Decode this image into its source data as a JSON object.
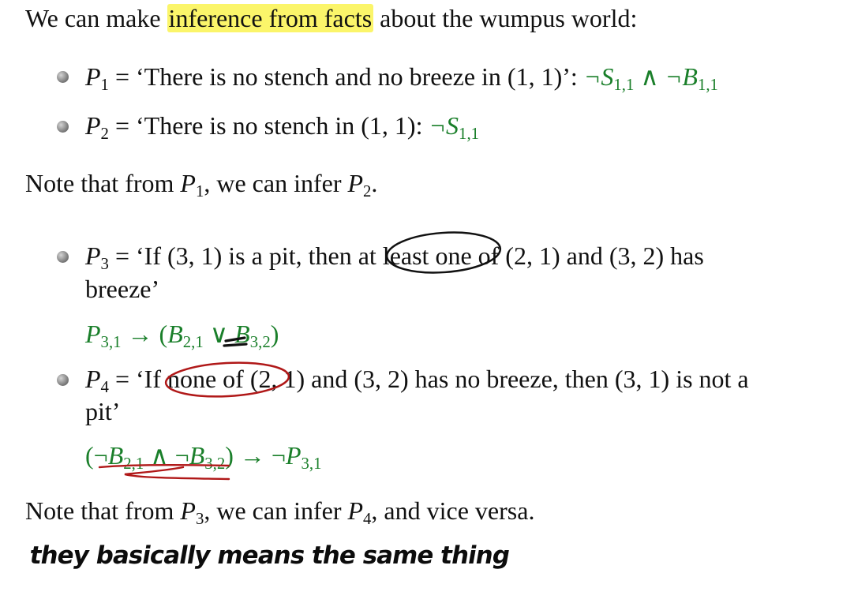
{
  "intro": {
    "before": "We can make ",
    "highlight": "inference from facts",
    "after": " about the wumpus world:"
  },
  "p1": {
    "var": "P",
    "sub": "1",
    "text": " = ‘There is no stench and no breeze in (1, 1)’: ",
    "formula": {
      "neg1": "¬S",
      "sub1": "1,1",
      "and": " ∧ ",
      "neg2": "¬B",
      "sub2": "1,1"
    }
  },
  "p2": {
    "var": "P",
    "sub": "2",
    "text": " = ‘There is no stench in (1, 1): ",
    "formula": {
      "neg": "¬S",
      "sub": "1,1"
    }
  },
  "note1": {
    "before": "Note that from ",
    "v1": "P",
    "s1": "1",
    "mid": ", we can infer ",
    "v2": "P",
    "s2": "2",
    "after": "."
  },
  "p3": {
    "var": "P",
    "sub": "3",
    "line1": " = ‘If (3, 1) is a pit, then at least one of (2, 1) and (3, 2) has",
    "line2": "breeze’",
    "formula": {
      "a": "P",
      "asub": "3,1",
      "arrow": " → (",
      "b": "B",
      "bsub": "2,1",
      "or": " ∨ ",
      "c": "B",
      "csub": "3,2",
      "close": ")"
    }
  },
  "p4": {
    "var": "P",
    "sub": "4",
    "line1": " = ‘If none of (2, 1) and (3, 2) has no breeze, then (3, 1) is not a",
    "line2": "pit’",
    "formula": {
      "open": "(¬",
      "a": "B",
      "asub": "2,1",
      "and": " ∧ ¬",
      "b": "B",
      "bsub": "3,2",
      "arrow": ") → ¬",
      "c": "P",
      "csub": "3,1"
    }
  },
  "note2": {
    "before": "Note that from ",
    "v1": "P",
    "s1": "3",
    "mid": ", we can infer ",
    "v2": "P",
    "s2": "4",
    "after": ", and vice versa."
  },
  "handwriting": "they basically means the same thing",
  "colors": {
    "formula": "#1a7f2a",
    "highlight": "#fbf56a",
    "ink_black": "#111111",
    "ink_red": "#b01818"
  }
}
